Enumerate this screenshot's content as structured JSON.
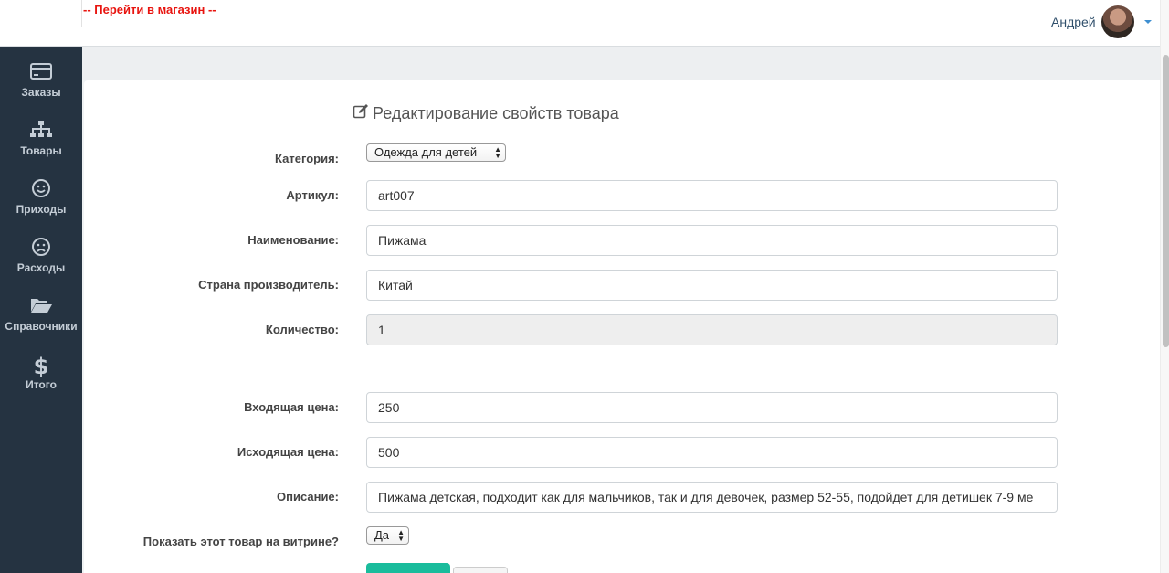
{
  "topbar": {
    "shop_link": "-- Перейти в магазин --",
    "user_name": "Андрей"
  },
  "sidebar": {
    "items": [
      {
        "label": "Заказы",
        "icon": "credit-card-icon"
      },
      {
        "label": "Товары",
        "icon": "sitemap-icon"
      },
      {
        "label": "Приходы",
        "icon": "smile-icon"
      },
      {
        "label": "Расходы",
        "icon": "frown-icon"
      },
      {
        "label": "Справочники",
        "icon": "folder-open-icon"
      },
      {
        "label": "Итого",
        "icon": "dollar-icon"
      }
    ]
  },
  "form": {
    "title": "Редактирование свойств товара",
    "category_label": "Категория:",
    "category_value": "Одежда для детей",
    "article_label": "Артикул:",
    "article_value": "art007",
    "name_label": "Наименование:",
    "name_value": "Пижама",
    "country_label": "Страна производитель:",
    "country_value": "Китай",
    "qty_label": "Количество:",
    "qty_value": "1",
    "in_price_label": "Входящая цена:",
    "in_price_value": "250",
    "out_price_label": "Исходящая цена:",
    "out_price_value": "500",
    "desc_label": "Описание:",
    "desc_value": "Пижама детская, подходит как для мальчиков, так и для девочек, размер 52-55, подойдет для детишек 7-9 ме",
    "show_label": "Показать этот товар на витрине?",
    "show_value": "Да"
  },
  "colors": {
    "sidebar_bg": "#253341",
    "accent_red": "#e8140f",
    "save_button": "#1abc9c"
  }
}
